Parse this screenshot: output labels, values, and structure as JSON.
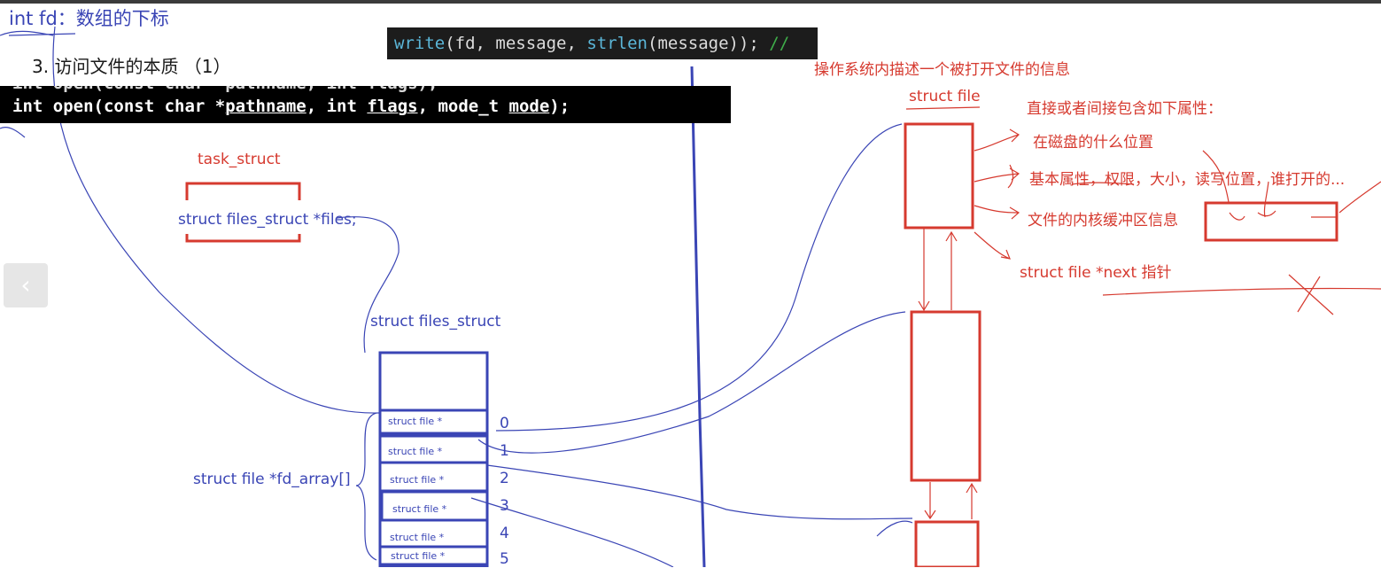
{
  "title_fd": "int fd：数组的下标",
  "section_heading": "3. 访问文件的本质 （1）",
  "code_write": {
    "fn1": "write",
    "args": "(fd, message, ",
    "fn2": "strlen",
    "rest": "(message)); ",
    "comment": "//"
  },
  "code_open": {
    "line1": "int open(const char *pathname, int flags);",
    "line2_a": "int open(const char *",
    "line2_pathname": "pathname",
    "line2_b": ", int ",
    "line2_flags": "flags",
    "line2_c": ", mode_t ",
    "line2_mode": "mode",
    "line2_d": ");"
  },
  "task_struct": {
    "label": "task_struct",
    "member": "struct files_struct *files;"
  },
  "files_struct": {
    "label": "struct files_struct",
    "fd_array_label": "struct file *fd_array[]",
    "cells": [
      "struct file *",
      "struct file *",
      "struct file *",
      "struct file *",
      "struct file *",
      "struct file *"
    ],
    "indices": [
      "0",
      "1",
      "2",
      "3",
      "4",
      "5"
    ]
  },
  "struct_file": {
    "description": "操作系统内描述一个被打开文件的信息",
    "label": "struct file",
    "attrs_heading": "直接或者间接包含如下属性：",
    "attrs": [
      "在磁盘的什么位置",
      "基本属性，权限，大小，读写位置，谁打开的...",
      "文件的内核缓冲区信息"
    ],
    "next_pointer": "struct file *next 指针"
  },
  "colors": {
    "blue": "#3a45b5",
    "red": "#d63a2f",
    "code_bg": "#1c1c1c"
  },
  "nav": {
    "back_icon": "chevron-left-icon",
    "back_glyph": "‹"
  }
}
